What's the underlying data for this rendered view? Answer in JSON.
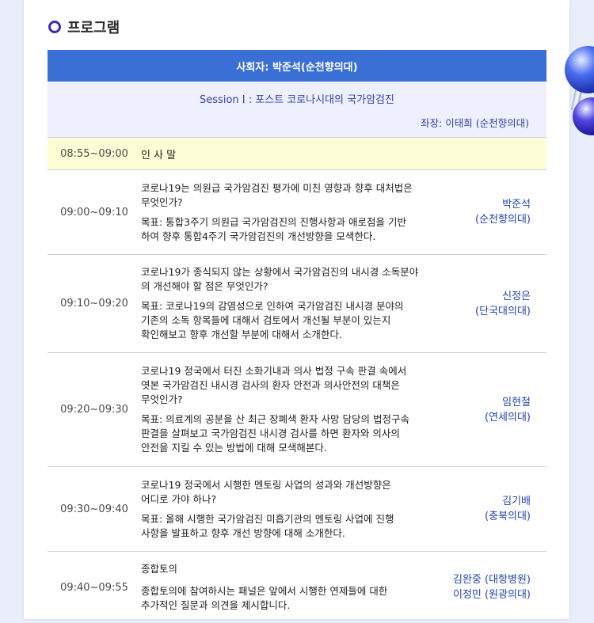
{
  "section": {
    "title": "프로그램"
  },
  "moderator": "사회자: 박준석(순천향의대)",
  "session": {
    "title": "Session I :  포스트 코로나시대의 국가암검진",
    "chair": "좌장: 이태희 (순천향의대)"
  },
  "greeting": {
    "time": "08:55~09:00",
    "text": "인 사 말"
  },
  "rows": [
    {
      "time": "09:00~09:10",
      "topic": [
        "코로나19는 의원급 국가암검진 평가에 미친 영향과 향후 대처법은",
        "무엇인가?"
      ],
      "goal": [
        "목표: 통합3주기 의원급 국가암검진의 진행사항과 애로점을 기반",
        "하여 향후 통합4주기 국가암검진의 개선방향을 모색한다."
      ],
      "speaker": [
        "박준석",
        "(순천향의대)"
      ]
    },
    {
      "time": "09:10~09:20",
      "topic": [
        "코로나19가 종식되지 않는 상황에서 국가암검진의 내시경 소독분야",
        "의 개선해야 할 점은 무엇인가?"
      ],
      "goal": [
        "목표: 코로나19의 감염성으로 인하여 국가암검진 내시경 분야의",
        "기존의 소독 항목들에 대해서 검토에서 개선될 부분이 있는지",
        "확인해보고 향후 개선할 부분에 대해서 소개한다."
      ],
      "speaker": [
        "신정은",
        "(단국대의대)"
      ]
    },
    {
      "time": "09:20~09:30",
      "topic": [
        "코로나19 정국에서 터진 소화기내과 의사 법정 구속 판결 속에서",
        "엿본 국가암검진 내시경 검사의 환자 안전과 의사안전의 대책은",
        "무엇인가?"
      ],
      "goal": [
        "목표: 의료계의 공분을 산 최근 장폐색 환자 사망 담당의 법정구속",
        "판결을 살펴보고 국가암검진 내시경 검사를 하면 환자와 의사의",
        "안전을 지킬 수 있는 방법에 대해 모색해본다."
      ],
      "speaker": [
        "임현철",
        "(연세의대)"
      ]
    },
    {
      "time": "09:30~09:40",
      "topic": [
        "코로나19 정국에서 시행한 멘토링 사업의 성과와 개선방향은",
        "어디로 가야 하나?"
      ],
      "goal": [
        "목표: 올해 시행한 국가암검진 미흡기관의 멘토링 사업에 진행",
        "사항을 발표하고 향후 개선 방향에 대해 소개한다."
      ],
      "speaker": [
        "김기배",
        "(충북의대)"
      ]
    },
    {
      "time": "09:40~09:55",
      "topic": [
        "종합토의"
      ],
      "goal": [
        "종합토의에 참여하시는 패널은 앞에서 시행한 연제들에 대한",
        "추가적인 질문과 의견을 제시합니다."
      ],
      "speaker": [
        "김완중 (대항병원)",
        "이정민 (원광의대)"
      ]
    }
  ],
  "colors": {
    "header_bg": "#3a6fd6",
    "session_bg": "#eef1fd",
    "greeting_bg": "#fdfed6",
    "accent_text": "#2244b0"
  }
}
